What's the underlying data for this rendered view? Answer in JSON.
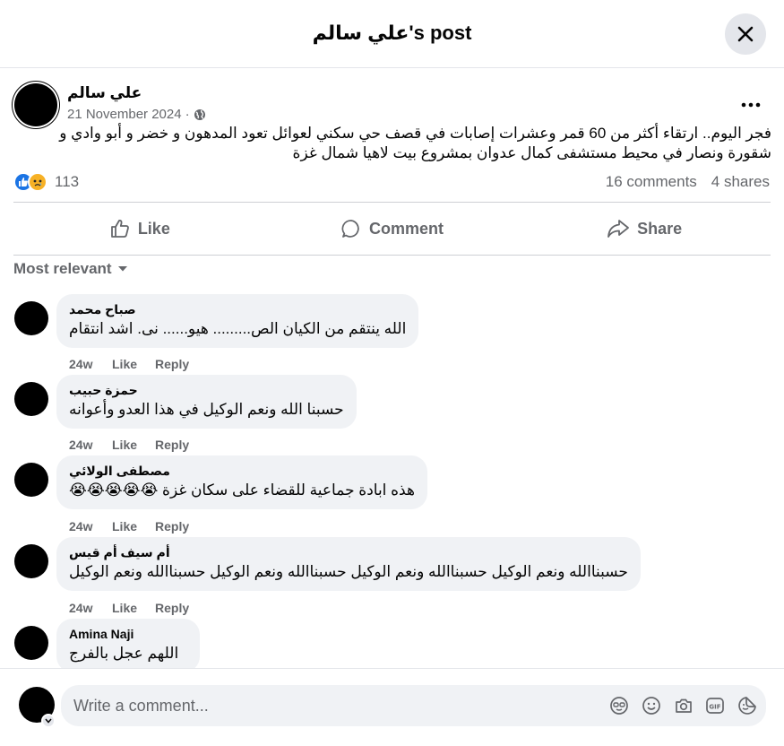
{
  "header": {
    "title": "علي سالم's post"
  },
  "post": {
    "author": "علي سالم",
    "date": "21 November 2024",
    "separator": "·",
    "text": "فجر اليوم.. ارتقاء أكثر من 60 قمر وعشرات إصابات في قصف حي سكني لعوائل تعود المدهون و خضر و أبو وادي و شقورة ونصار في محيط مستشفى كمال عدوان بمشروع بيت لاهيا شمال غزة",
    "reaction_count": "113",
    "comments_count": "16 comments",
    "shares_count": "4 shares",
    "reaction_icons": [
      "like-icon",
      "sad-icon"
    ]
  },
  "actions": {
    "like": "Like",
    "comment": "Comment",
    "share": "Share"
  },
  "sort_label": "Most relevant",
  "comments": [
    {
      "name": "صباح محمد",
      "text": "الله ينتقم من الكيان الص......... هيو...... نى. اشد انتقام",
      "time": "24w",
      "like": "Like",
      "reply": "Reply"
    },
    {
      "name": "حمزة حبيب",
      "text": "حسبنا الله ونعم الوكيل في هذا العدو وأعوانه",
      "time": "24w",
      "like": "Like",
      "reply": "Reply"
    },
    {
      "name": "مصطفى الولائي",
      "text": "هذه ابادة جماعية للقضاء على سكان غزة 😭😭😭😭😭",
      "time": "24w",
      "like": "Like",
      "reply": "Reply"
    },
    {
      "name": "أم سيف أم قيس",
      "text": "حسبناالله ونعم الوكيل حسبناالله ونعم الوكيل حسبناالله ونعم الوكيل حسبناالله ونعم الوكيل",
      "time": "24w",
      "like": "Like",
      "reply": "Reply"
    },
    {
      "name": "Amina Naji",
      "text": "اللهم عجل بالفرج"
    }
  ],
  "composer": {
    "placeholder": "Write a comment...",
    "tools": [
      "avatar-sticker-icon",
      "emoji-icon",
      "camera-icon",
      "gif-icon",
      "sticker-icon"
    ]
  },
  "colors": {
    "primary": "#1b74e4",
    "secondary_text": "#65676b",
    "bubble": "#f0f2f5"
  }
}
